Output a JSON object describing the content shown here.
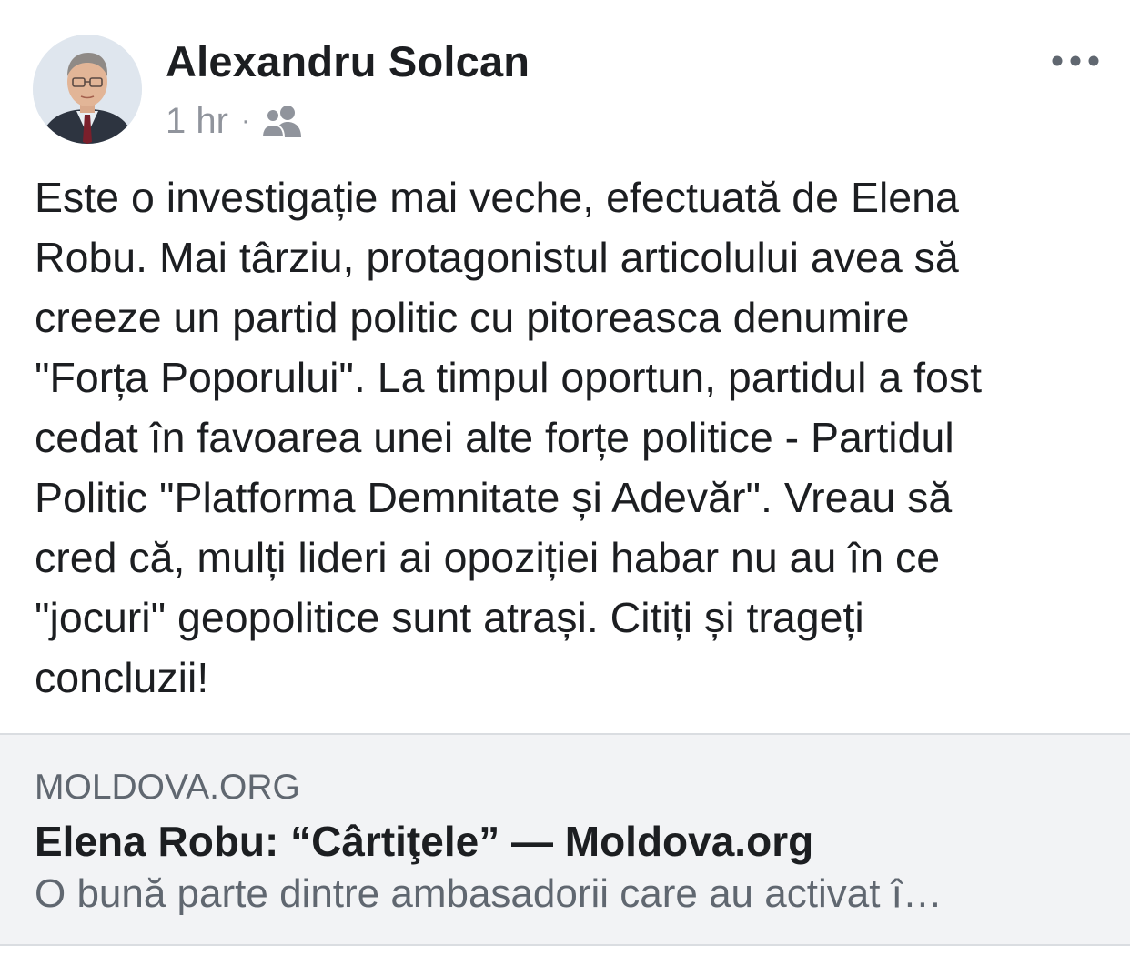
{
  "post": {
    "author": "Alexandru Solcan",
    "time": "1 hr",
    "separator": "·",
    "audience_icon": "friends-icon",
    "more_icon": "more-horizontal-icon",
    "text": "Este o investigație mai veche,  efectuată de Elena\nRobu. Mai târziu, protagonistul articolului avea să\ncreeze un partid politic cu pitoreasca denumire\n\"Forța Poporului\". La timpul oportun, partidul a fost\ncedat în favoarea unei alte forțe politice - Partidul\nPolitic \"Platforma Demnitate și Adevăr\". Vreau să\ncred că, mulți lideri ai opoziției habar nu au în ce\n\"jocuri\" geopolitice sunt atrași. Citiți și trageți\nconcluzii!"
  },
  "link_preview": {
    "domain": "MOLDOVA.ORG",
    "title": "Elena Robu: “Cârtiţele” — Moldova.org",
    "description": "O bună parte dintre ambasadorii care au activat î…"
  },
  "colors": {
    "text_primary": "#1c1e21",
    "text_secondary": "#90949c",
    "card_background": "#f2f3f5",
    "card_border": "#dadde1"
  }
}
